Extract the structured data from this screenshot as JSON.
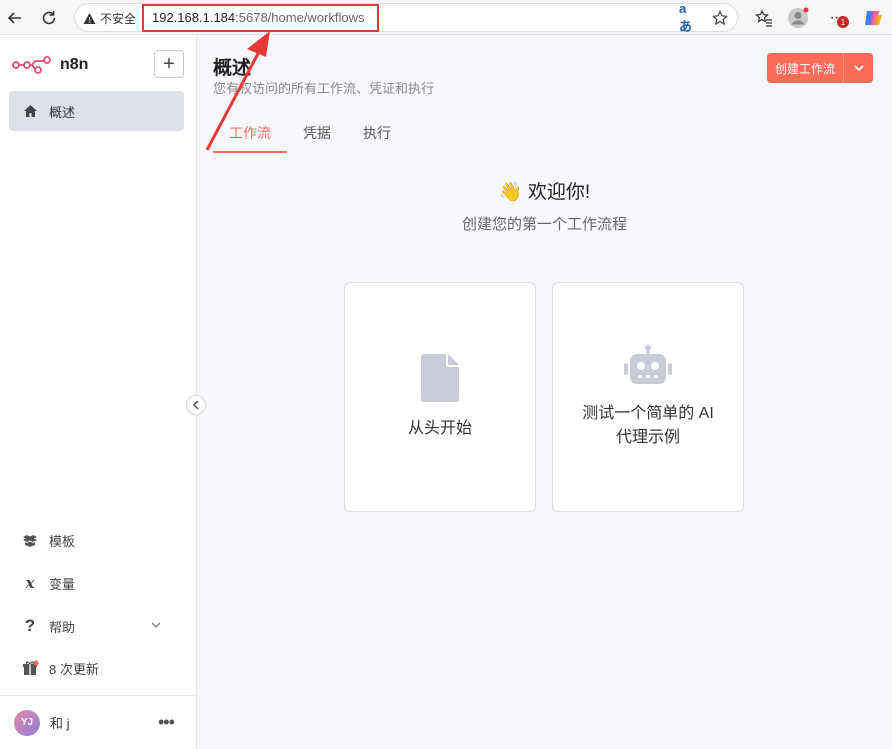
{
  "browser": {
    "security_label": "不安全",
    "url_host": "192.168.1.184",
    "url_path": ":5678/home/workflows",
    "update_badge": "1"
  },
  "sidebar": {
    "brand": "n8n",
    "items": [
      {
        "label": "概述",
        "icon": "home-icon"
      }
    ],
    "bottom_items": [
      {
        "label": "模板",
        "icon": "box-icon"
      },
      {
        "label": "变量",
        "icon": "variable-icon"
      },
      {
        "label": "帮助",
        "icon": "question-icon"
      },
      {
        "label": "8 次更新",
        "icon": "gift-icon"
      }
    ],
    "user": {
      "initials": "YJ",
      "name": "和 j"
    }
  },
  "main": {
    "title": "概述",
    "subtitle": "您有权访问的所有工作流、凭证和执行",
    "create_button": "创建工作流",
    "tabs": [
      {
        "label": "工作流",
        "active": true
      },
      {
        "label": "凭据",
        "active": false
      },
      {
        "label": "执行",
        "active": false
      }
    ],
    "welcome_emoji": "👋",
    "welcome_title": "欢迎你!",
    "welcome_subtitle": "创建您的第一个工作流程",
    "cards": [
      {
        "label": "从头开始",
        "icon": "file-icon"
      },
      {
        "label": "测试一个简单的 AI 代理示例",
        "icon": "robot-icon"
      }
    ]
  },
  "colors": {
    "accent": "#ff6d5a",
    "annotation_red": "#e53935"
  }
}
